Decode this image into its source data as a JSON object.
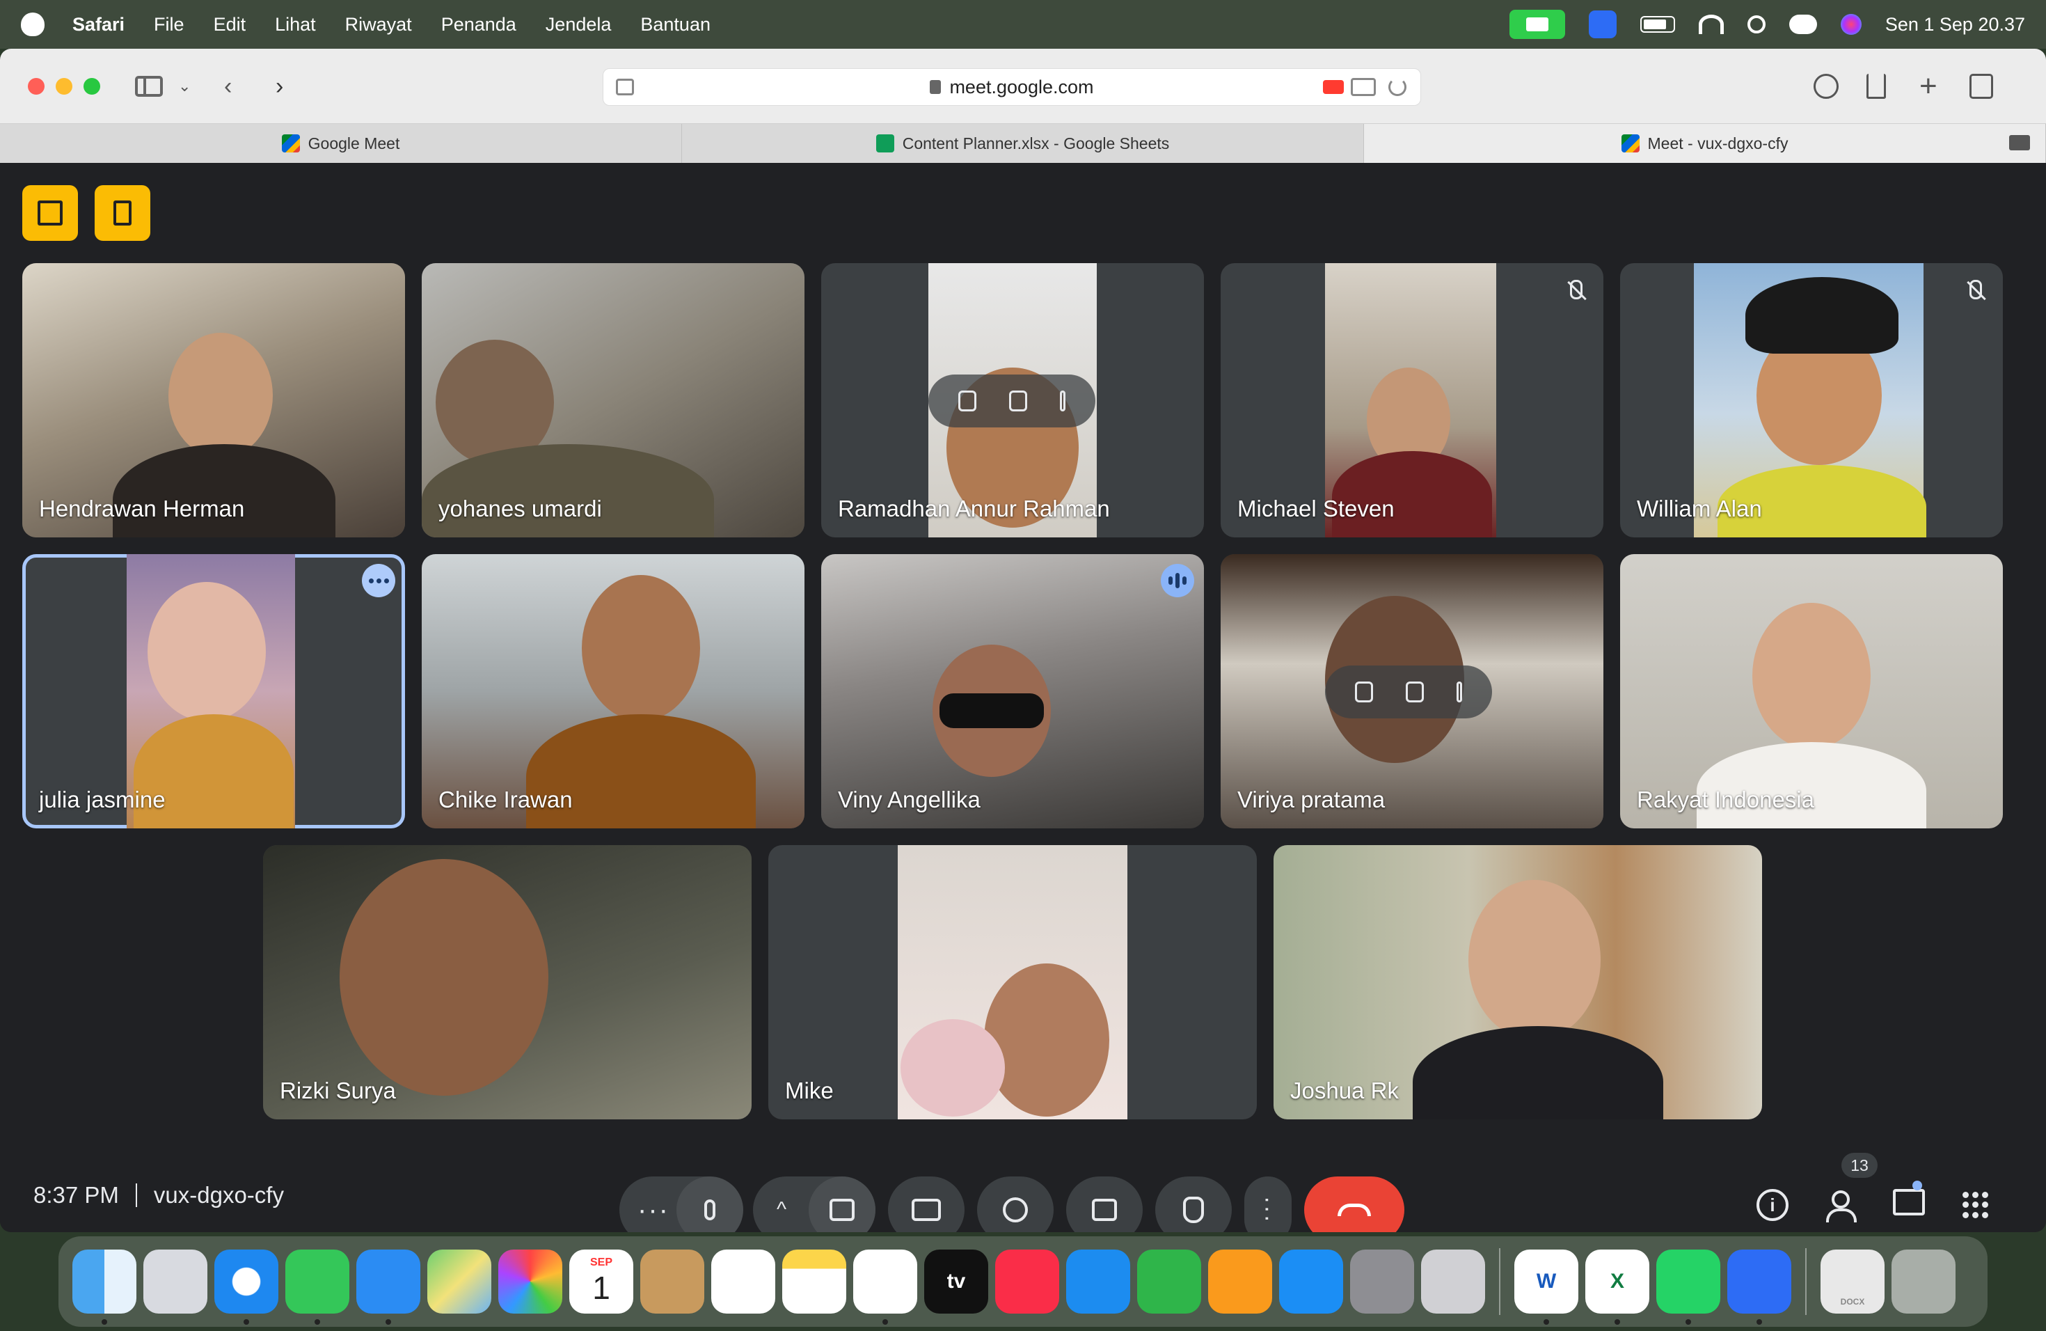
{
  "menubar": {
    "app": "Safari",
    "items": [
      "File",
      "Edit",
      "Lihat",
      "Riwayat",
      "Penanda",
      "Jendela",
      "Bantuan"
    ],
    "clock": "Sen 1 Sep  20.37"
  },
  "browser": {
    "url": "meet.google.com",
    "tabs": [
      {
        "label": "Google Meet"
      },
      {
        "label": "Content Planner.xlsx - Google Sheets"
      },
      {
        "label": "Meet - vux-dgxo-cfy"
      }
    ]
  },
  "participants": [
    {
      "name": "Hendrawan Herman"
    },
    {
      "name": "yohanes umardi"
    },
    {
      "name": "Ramadhan Annur Rahman"
    },
    {
      "name": "Michael Steven"
    },
    {
      "name": "William Alan"
    },
    {
      "name": "julia jasmine"
    },
    {
      "name": "Chike Irawan"
    },
    {
      "name": "Viny Angellika"
    },
    {
      "name": "Viriya pratama"
    },
    {
      "name": "Rakyat Indonesia"
    },
    {
      "name": "Rizki Surya"
    },
    {
      "name": "Mike"
    },
    {
      "name": "Joshua Rk"
    }
  ],
  "meeting": {
    "time": "8:37 PM",
    "code": "vux-dgxo-cfy",
    "participant_count": "13"
  },
  "dock": {
    "calendar_month": "SEP",
    "calendar_day": "1",
    "tv_label": "tv",
    "word_letter": "W",
    "excel_letter": "X",
    "docx_label": "DOCX"
  },
  "colors": {
    "meet_bg": "#202124",
    "tile_bg": "#3c4043",
    "end_call": "#ea4335",
    "host_controls": "#fbbc04",
    "active_outline": "#a8c7fa"
  }
}
